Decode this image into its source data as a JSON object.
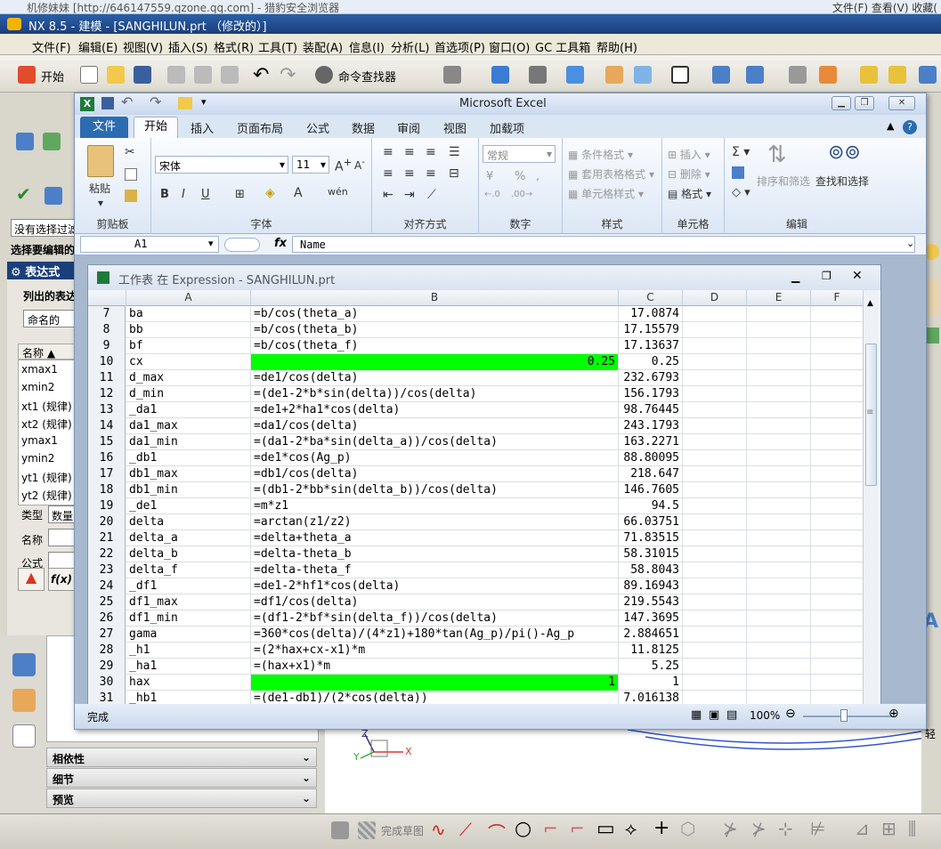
{
  "browser": {
    "title": "机修妹妹 [http://646147559.qzone.qq.com] - 猎豹安全浏览器",
    "menu": "文件(F)   查看(V)   收藏("
  },
  "nx": {
    "title": "NX 8.5 - 建模 - [SANGHILUN.prt （修改的）]",
    "menu": [
      "文件(F)",
      "编辑(E)",
      "视图(V)",
      "插入(S)",
      "格式(R)",
      "工具(T)",
      "装配(A)",
      "信息(I)",
      "分析(L)",
      "首选项(P)",
      "窗口(O)",
      "GC 工具箱",
      "帮助(H)"
    ],
    "toolbar": {
      "start": "开始",
      "command_finder": "命令查找器",
      "finish_sketch": "完成草图"
    },
    "left": {
      "no_filter": "没有选择过滤",
      "select_edit": "选择要编辑的",
      "expr_title": "表达式",
      "listed": "列出的表达式",
      "named": "命名的",
      "col_name": "名称",
      "items": [
        "xmax1",
        "xmin2",
        "xt1 (规律)",
        "xt2 (规律)",
        "ymax1",
        "ymin2",
        "yt1 (规律)",
        "yt2 (规律)"
      ],
      "type_label": "类型",
      "type_value": "数量",
      "name_label": "名称",
      "formula_label": "公式"
    },
    "sections": [
      "相依性",
      "细节",
      "预览"
    ],
    "right_label": "轻"
  },
  "excel": {
    "title": "Microsoft Excel",
    "tabs": [
      "文件",
      "开始",
      "插入",
      "页面布局",
      "公式",
      "数据",
      "审阅",
      "视图",
      "加载项"
    ],
    "ribbon": {
      "paste": "粘贴",
      "clipboard": "剪贴板",
      "font_name": "宋体",
      "font_size": "11",
      "font_group": "字体",
      "align_group": "对齐方式",
      "number_format": "常规",
      "number_group": "数字",
      "cond_format": "条件格式",
      "table_format": "套用表格格式",
      "cell_style": "单元格样式",
      "style_group": "样式",
      "insert": "插入",
      "delete": "删除",
      "format": "格式",
      "cells_group": "单元格",
      "sort_filter": "排序和筛选",
      "find_select": "查找和选择",
      "edit_group": "编辑"
    },
    "name_box": "A1",
    "formula": "Name",
    "sheet_title": "工作表 在 Expression - SANGHILUN.prt",
    "columns": [
      "A",
      "B",
      "C",
      "D",
      "E",
      "F"
    ],
    "rows": [
      {
        "n": "7",
        "a": "ba",
        "b": "=b/cos(theta_a)",
        "c": "17.0874"
      },
      {
        "n": "8",
        "a": "bb",
        "b": "=b/cos(theta_b)",
        "c": "17.15579"
      },
      {
        "n": "9",
        "a": "bf",
        "b": "=b/cos(theta_f)",
        "c": "17.13637"
      },
      {
        "n": "10",
        "a": "cx",
        "b": "0.25",
        "c": "0.25",
        "green": true
      },
      {
        "n": "11",
        "a": "d_max",
        "b": "=de1/cos(delta)",
        "c": "232.6793"
      },
      {
        "n": "12",
        "a": "d_min",
        "b": "=(de1-2*b*sin(delta))/cos(delta)",
        "c": "156.1793"
      },
      {
        "n": "13",
        "a": "_da1",
        "b": "=de1+2*ha1*cos(delta)",
        "c": "98.76445"
      },
      {
        "n": "14",
        "a": "da1_max",
        "b": "=da1/cos(delta)",
        "c": "243.1793"
      },
      {
        "n": "15",
        "a": "da1_min",
        "b": "=(da1-2*ba*sin(delta_a))/cos(delta)",
        "c": "163.2271"
      },
      {
        "n": "16",
        "a": "_db1",
        "b": "=de1*cos(Ag_p)",
        "c": "88.80095"
      },
      {
        "n": "17",
        "a": "db1_max",
        "b": "=db1/cos(delta)",
        "c": "218.647"
      },
      {
        "n": "18",
        "a": "db1_min",
        "b": "=(db1-2*bb*sin(delta_b))/cos(delta)",
        "c": "146.7605"
      },
      {
        "n": "19",
        "a": "_de1",
        "b": "=m*z1",
        "c": "94.5"
      },
      {
        "n": "20",
        "a": "delta",
        "b": "=arctan(z1/z2)",
        "c": "66.03751"
      },
      {
        "n": "21",
        "a": "delta_a",
        "b": "=delta+theta_a",
        "c": "71.83515"
      },
      {
        "n": "22",
        "a": "delta_b",
        "b": "=delta-theta_b",
        "c": "58.31015"
      },
      {
        "n": "23",
        "a": "delta_f",
        "b": "=delta-theta_f",
        "c": "58.8043"
      },
      {
        "n": "24",
        "a": "_df1",
        "b": "=de1-2*hf1*cos(delta)",
        "c": "89.16943"
      },
      {
        "n": "25",
        "a": "df1_max",
        "b": "=df1/cos(delta)",
        "c": "219.5543"
      },
      {
        "n": "26",
        "a": "df1_min",
        "b": "=(df1-2*bf*sin(delta_f))/cos(delta)",
        "c": "147.3695"
      },
      {
        "n": "27",
        "a": "gama",
        "b": "=360*cos(delta)/(4*z1)+180*tan(Ag_p)/pi()-Ag_p",
        "c": "2.884651"
      },
      {
        "n": "28",
        "a": "_h1",
        "b": "=(2*hax+cx-x1)*m",
        "c": "11.8125"
      },
      {
        "n": "29",
        "a": "_ha1",
        "b": "=(hax+x1)*m",
        "c": "5.25"
      },
      {
        "n": "30",
        "a": "hax",
        "b": "1",
        "c": "1",
        "green": true
      },
      {
        "n": "31",
        "a": "_hb1",
        "b": "=(de1-db1)/(2*cos(delta))",
        "c": "7.016138"
      }
    ],
    "status": "完成",
    "zoom": "100%"
  },
  "colors": {
    "green_cell": "#00ff00",
    "excel_file_tab": "#2b6cb0",
    "nx_title": "#1b3f7a"
  }
}
